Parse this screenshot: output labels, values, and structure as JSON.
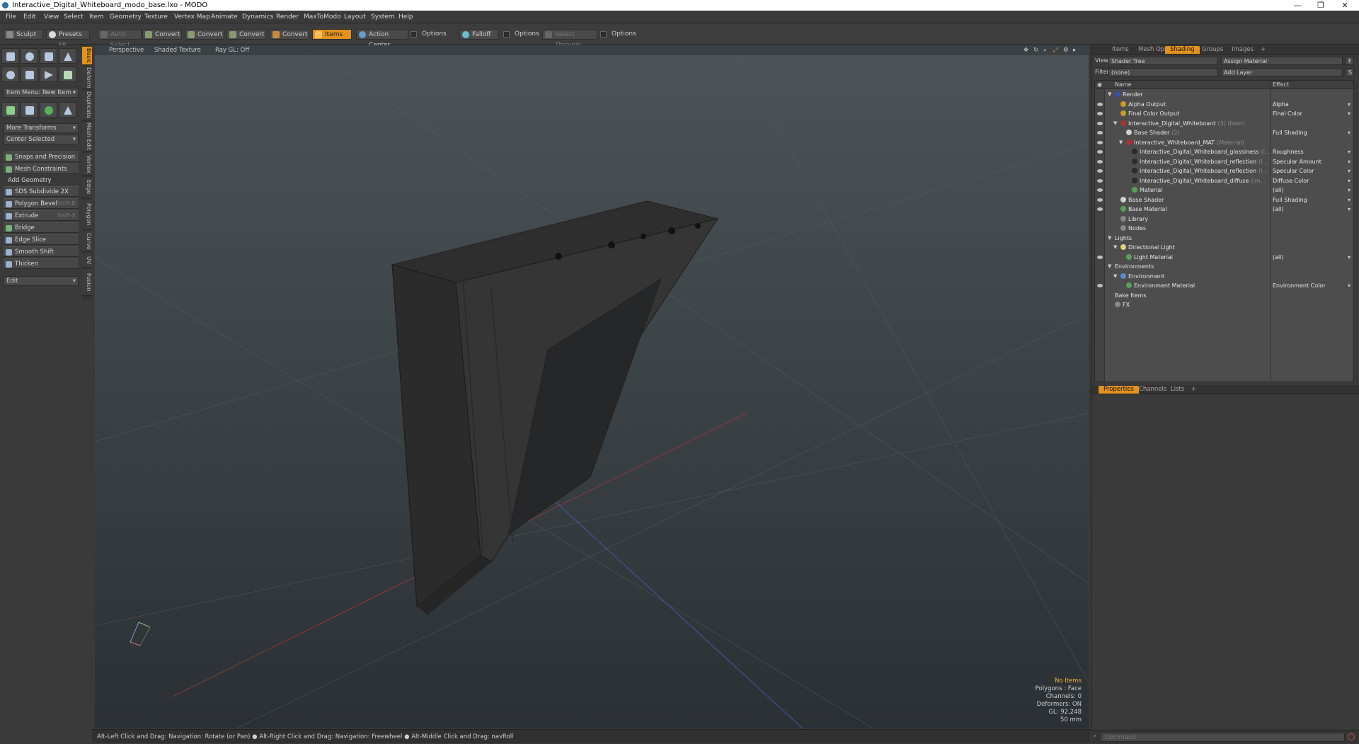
{
  "window": {
    "title": "Interactive_Digital_Whiteboard_modo_base.lxo - MODO",
    "controls": {
      "minimize": "—",
      "restore": "❐",
      "close": "✕"
    }
  },
  "menubar": [
    "File",
    "Edit",
    "View",
    "Select",
    "Item",
    "Geometry",
    "Texture",
    "Vertex Map",
    "Animate",
    "Dynamics",
    "Render",
    "MaxToModo",
    "Layout",
    "System",
    "Help"
  ],
  "toolbar": {
    "sculpt": "Sculpt",
    "presets": "Presets",
    "presets_key": "F6",
    "auto_select": "Auto Select",
    "convert1": "Convert",
    "convert2": "Convert",
    "convert3": "Convert",
    "convert4": "Convert",
    "items": "Items",
    "action_center": "Action Center",
    "options1": "Options",
    "falloff": "Falloff",
    "options2": "Options",
    "select_through": "Select Through",
    "options3": "Options"
  },
  "left_tabs": [
    "Basic",
    "Deform",
    "Duplicate",
    "Mesh Edit",
    "Vertex",
    "Edge",
    "Polygon",
    "Curve",
    "UV",
    "Fusion"
  ],
  "left_panel": {
    "item_menu": "Item Menu: New Item",
    "more_transforms": "More Transforms",
    "center_selected": "Center Selected",
    "snaps": "Snaps and Precision",
    "mesh_constraints": "Mesh Constraints",
    "add_geometry": "Add Geometry",
    "sds_subdivide": "SDS Subdivide 2X",
    "polygon_bevel": "Polygon Bevel",
    "polygon_bevel_key": "Shift-B",
    "extrude": "Extrude",
    "extrude_key": "Shift-X",
    "bridge": "Bridge",
    "edge_slice": "Edge Slice",
    "smooth_shift": "Smooth Shift",
    "thicken": "Thicken",
    "edit": "Edit"
  },
  "viewport": {
    "view": "Perspective",
    "shading": "Shaded Texture",
    "raygl": "Ray GL: Off",
    "info": {
      "selection": "No Items",
      "polygons": "Polygons : Face",
      "channels": "Channels: 0",
      "deformers": "Deformers: ON",
      "gl": "GL: 92,248",
      "focal": "50 mm"
    }
  },
  "right_panel": {
    "tabs": [
      "Items",
      "Mesh Ops",
      "Shading",
      "Groups",
      "Images",
      "+"
    ],
    "active_tab": "Shading",
    "view_label": "View",
    "view_value": "Shader Tree",
    "assign_material": "Assign Material",
    "f_key": "F",
    "filter_label": "Filter",
    "filter_value": "(none)",
    "add_layer": "Add Layer",
    "s_key": "S",
    "col_name": "Name",
    "col_effect": "Effect",
    "tree": [
      {
        "name": "Render",
        "sub": "",
        "effect": "",
        "icon": "#3a4fb0",
        "indent": 0
      },
      {
        "name": "Alpha Output",
        "sub": "",
        "effect": "Alpha",
        "icon": "#c89a2a",
        "indent": 1
      },
      {
        "name": "Final Color Output",
        "sub": "",
        "effect": "Final Color",
        "icon": "#c89a2a",
        "indent": 1
      },
      {
        "name": "Interactive_Digital_Whiteboard",
        "sub": "(3) (Item)",
        "effect": "",
        "icon": "#b03030",
        "indent": 1
      },
      {
        "name": "Base Shader",
        "sub": "(2)",
        "effect": "Full Shading",
        "icon": "#d0d0d0",
        "indent": 2
      },
      {
        "name": "Interactive_Whiteboard_MAT",
        "sub": "(Material)",
        "effect": "",
        "icon": "#b03030",
        "indent": 2
      },
      {
        "name": "Interactive_Digital_Whiteboard_glossiness",
        "sub": "(I...",
        "effect": "Roughness",
        "icon": "#2a2a2a",
        "indent": 3
      },
      {
        "name": "Interactive_Digital_Whiteboard_reflection",
        "sub": "(I...",
        "effect": "Specular Amount",
        "icon": "#2a2a2a",
        "indent": 3
      },
      {
        "name": "Interactive_Digital_Whiteboard_reflection",
        "sub": "(I...",
        "effect": "Specular Color",
        "icon": "#2a2a2a",
        "indent": 3
      },
      {
        "name": "Interactive_Digital_Whiteboard_diffuse",
        "sub": "(Im...",
        "effect": "Diffuse Color",
        "icon": "#2a2a2a",
        "indent": 3
      },
      {
        "name": "Material",
        "sub": "",
        "effect": "(all)",
        "icon": "#5aa05a",
        "indent": 3
      },
      {
        "name": "Base Shader",
        "sub": "",
        "effect": "Full Shading",
        "icon": "#d0d0d0",
        "indent": 1
      },
      {
        "name": "Base Material",
        "sub": "",
        "effect": "(all)",
        "icon": "#5aa05a",
        "indent": 1
      },
      {
        "name": "Library",
        "sub": "",
        "effect": "",
        "icon": "#888888",
        "indent": 1
      },
      {
        "name": "Nodes",
        "sub": "",
        "effect": "",
        "icon": "#888888",
        "indent": 1
      },
      {
        "name": "Lights",
        "sub": "",
        "effect": "",
        "icon": "",
        "indent": 0
      },
      {
        "name": "Directional Light",
        "sub": "",
        "effect": "",
        "icon": "#e0d080",
        "indent": 1
      },
      {
        "name": "Light Material",
        "sub": "",
        "effect": "(all)",
        "icon": "#5aa05a",
        "indent": 2
      },
      {
        "name": "Environments",
        "sub": "",
        "effect": "",
        "icon": "",
        "indent": 0
      },
      {
        "name": "Environment",
        "sub": "",
        "effect": "",
        "icon": "#5a8ac0",
        "indent": 1
      },
      {
        "name": "Environment Material",
        "sub": "",
        "effect": "Environment Color",
        "icon": "#5aa05a",
        "indent": 2
      },
      {
        "name": "Bake Items",
        "sub": "",
        "effect": "",
        "icon": "",
        "indent": 0
      },
      {
        "name": "FX",
        "sub": "",
        "effect": "",
        "icon": "#888888",
        "indent": 0
      }
    ],
    "bottom_tabs": [
      "Properties",
      "Channels",
      "Lists",
      "+"
    ],
    "bottom_active": "Properties",
    "command_placeholder": "Command"
  },
  "statusbar": "Alt-Left Click and Drag: Navigation: Rotate (or Pan) ● Alt-Right Click and Drag: Navigation: Freewheel ● Alt-Middle Click and Drag: navRoll",
  "colors": {
    "accent": "#e3931d",
    "viewport_top": "#4d5458",
    "viewport_bottom": "#2b3034"
  }
}
